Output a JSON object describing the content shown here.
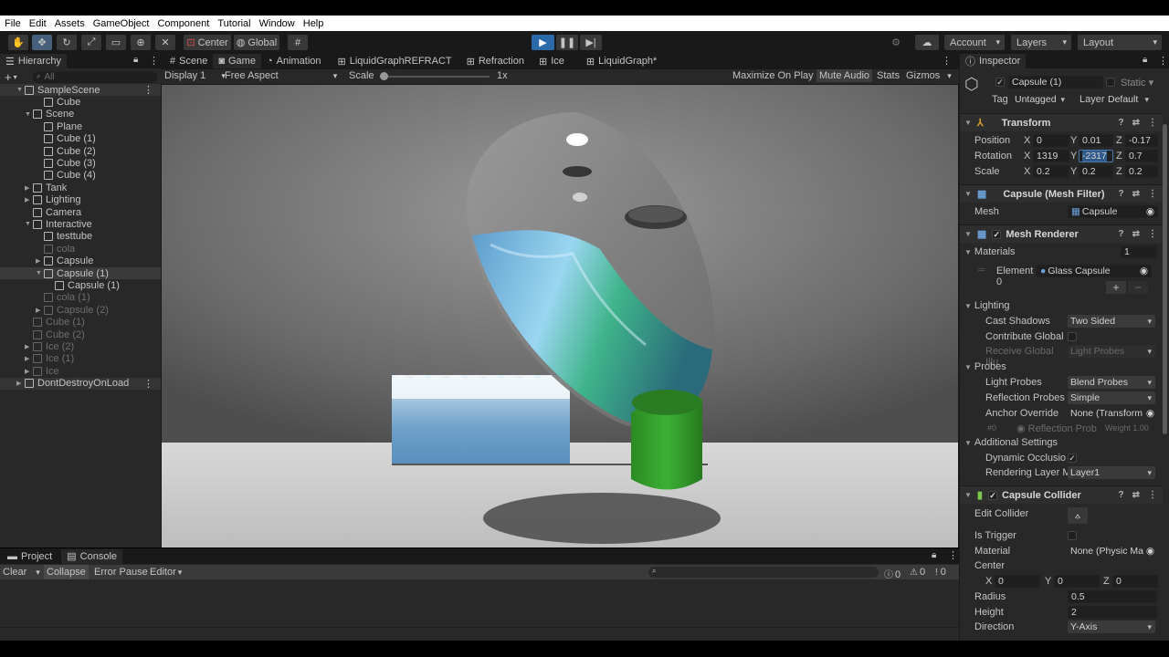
{
  "menu": [
    "File",
    "Edit",
    "Assets",
    "GameObject",
    "Component",
    "Tutorial",
    "Window",
    "Help"
  ],
  "toolbar": {
    "pivot_label": "Center",
    "space_label": "Global",
    "account_label": "Account",
    "layers_label": "Layers",
    "layout_label": "Layout"
  },
  "hierarchy": {
    "tab": "Hierarchy",
    "search_placeholder": "All",
    "rows": [
      {
        "label": "SampleScene",
        "indent": 0,
        "type": "scene",
        "arrow": "▼"
      },
      {
        "label": "Cube",
        "indent": 2,
        "arrow": ""
      },
      {
        "label": "Scene",
        "indent": 1,
        "arrow": "▼"
      },
      {
        "label": "Plane",
        "indent": 2,
        "arrow": ""
      },
      {
        "label": "Cube (1)",
        "indent": 2,
        "arrow": ""
      },
      {
        "label": "Cube (2)",
        "indent": 2,
        "arrow": ""
      },
      {
        "label": "Cube (3)",
        "indent": 2,
        "arrow": ""
      },
      {
        "label": "Cube (4)",
        "indent": 2,
        "arrow": ""
      },
      {
        "label": "Tank",
        "indent": 1,
        "arrow": "▶"
      },
      {
        "label": "Lighting",
        "indent": 1,
        "arrow": "▶"
      },
      {
        "label": "Camera",
        "indent": 1,
        "arrow": ""
      },
      {
        "label": "Interactive",
        "indent": 1,
        "arrow": "▼"
      },
      {
        "label": "testtube",
        "indent": 2,
        "arrow": ""
      },
      {
        "label": "cola",
        "indent": 2,
        "arrow": "",
        "dim": true
      },
      {
        "label": "Capsule",
        "indent": 2,
        "arrow": "▶"
      },
      {
        "label": "Capsule (1)",
        "indent": 2,
        "arrow": "▼",
        "selected": true
      },
      {
        "label": "Capsule (1)",
        "indent": 3,
        "arrow": ""
      },
      {
        "label": "cola (1)",
        "indent": 2,
        "arrow": "",
        "dim": true
      },
      {
        "label": "Capsule (2)",
        "indent": 2,
        "arrow": "▶",
        "dim": true
      },
      {
        "label": "Cube (1)",
        "indent": 1,
        "arrow": "",
        "dim": true
      },
      {
        "label": "Cube (2)",
        "indent": 1,
        "arrow": "",
        "dim": true
      },
      {
        "label": "Ice (2)",
        "indent": 1,
        "arrow": "▶",
        "dim": true
      },
      {
        "label": "Ice (1)",
        "indent": 1,
        "arrow": "▶",
        "dim": true
      },
      {
        "label": "Ice",
        "indent": 1,
        "arrow": "▶",
        "dim": true
      },
      {
        "label": "DontDestroyOnLoad",
        "indent": 0,
        "type": "scene",
        "arrow": "▶"
      }
    ]
  },
  "game": {
    "tabs": [
      "Scene",
      "Game",
      "Animation",
      "LiquidGraphREFRACT",
      "Refraction",
      "Ice",
      "LiquidGraph*"
    ],
    "display": "Display 1",
    "aspect": "Free Aspect",
    "scale_label": "Scale",
    "scale_value": "1x",
    "maximize": "Maximize On Play",
    "mute": "Mute Audio",
    "stats": "Stats",
    "gizmos": "Gizmos"
  },
  "console": {
    "tabs": [
      "Project",
      "Console"
    ],
    "clear": "Clear",
    "collapse": "Collapse",
    "error_pause": "Error Pause",
    "editor": "Editor",
    "count_log": "0",
    "count_warn": "0",
    "count_error": "0"
  },
  "inspector": {
    "tab": "Inspector",
    "object_name": "Capsule (1)",
    "static_label": "Static",
    "tag_label": "Tag",
    "tag_value": "Untagged",
    "layer_label": "Layer",
    "layer_value": "Default",
    "transform": {
      "title": "Transform",
      "position_label": "Position",
      "pos_x": "0",
      "pos_y": "0.01",
      "pos_z": "-0.17",
      "rotation_label": "Rotation",
      "rot_x": "1319",
      "rot_y": "-2317",
      "rot_z": "0.7",
      "scale_label": "Scale",
      "scale_x": "0.2",
      "scale_y": "0.2",
      "scale_z": "0.2"
    },
    "mesh_filter": {
      "title": "Capsule (Mesh Filter)",
      "mesh_label": "Mesh",
      "mesh_value": "Capsule"
    },
    "mesh_renderer": {
      "title": "Mesh Renderer",
      "materials_label": "Materials",
      "materials_count": "1",
      "element_label": "Element 0",
      "element_value": "Glass Capsule",
      "lighting_label": "Lighting",
      "cast_shadows_label": "Cast Shadows",
      "cast_shadows_value": "Two Sided",
      "contribute_gi_label": "Contribute Global",
      "receive_gi_label": "Receive Global Illu",
      "receive_gi_value": "Light Probes",
      "probes_label": "Probes",
      "light_probes_label": "Light Probes",
      "light_probes_value": "Blend Probes",
      "refl_probes_label": "Reflection Probes",
      "refl_probes_value": "Simple",
      "anchor_label": "Anchor Override",
      "anchor_value": "None (Transform",
      "probe_idx": "#0",
      "probe_name": "Reflection Prob",
      "probe_weight": "Weight 1.00",
      "additional_label": "Additional Settings",
      "dyn_occ_label": "Dynamic Occlusio",
      "render_layer_label": "Rendering Layer M",
      "render_layer_value": "Layer1"
    },
    "capsule_collider": {
      "title": "Capsule Collider",
      "edit_label": "Edit Collider",
      "trigger_label": "Is Trigger",
      "material_label": "Material",
      "material_value": "None (Physic Ma",
      "center_label": "Center",
      "cx": "0",
      "cy": "0",
      "cz": "0",
      "radius_label": "Radius",
      "radius_value": "0.5",
      "height_label": "Height",
      "height_value": "2",
      "direction_label": "Direction",
      "direction_value": "Y-Axis"
    }
  },
  "colors": {
    "accent": "#46607c",
    "play_active": "#2a6aa8",
    "liquid_blue": "#5e9ccc",
    "liquid_green": "#3fb48a",
    "tube_green": "#2f9a28"
  }
}
